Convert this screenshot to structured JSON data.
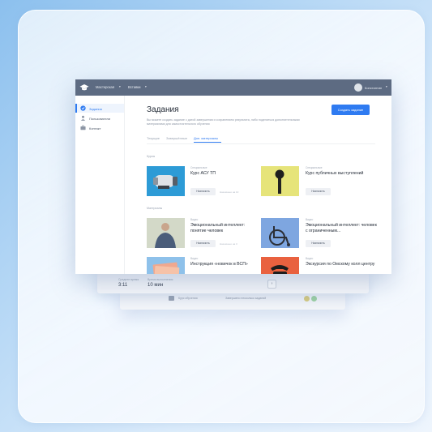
{
  "topbar": {
    "nav": [
      "Мастерская",
      "Вставки"
    ],
    "user": "Константин"
  },
  "sidebar": {
    "items": [
      {
        "label": "Задания",
        "active": true
      },
      {
        "label": "Пользователи",
        "active": false
      },
      {
        "label": "Контакт",
        "active": false
      }
    ]
  },
  "page": {
    "title": "Задания",
    "description": "Вы можете создать задание с датой завершения и сохранением результата, либо поделиться дополнительными материалами для самостоятельного обучения",
    "create_button": "Создать задание"
  },
  "tabs": [
    {
      "label": "Текущие",
      "active": false
    },
    {
      "label": "Завершённые",
      "active": false
    },
    {
      "label": "Доп. материалы",
      "active": true
    }
  ],
  "sections": {
    "courses": "Курсы",
    "materials": "Материалы"
  },
  "cards": [
    {
      "category": "Специальные",
      "title": "Курс АСУ ТП",
      "button": "Назначить",
      "meta": "Назначено на 10"
    },
    {
      "category": "Специальные",
      "title": "Курс публичных выступлений",
      "button": "Назначить",
      "meta": ""
    },
    {
      "category": "Видео",
      "title": "Эмоциональный интеллект: понятие человек",
      "button": "Назначить",
      "meta": "Назначено на 3"
    },
    {
      "category": "Видео",
      "title": "Эмоциональный интеллект: человек с ограниченным...",
      "button": "Назначить",
      "meta": ""
    },
    {
      "category": "Видео",
      "title": "Инструкция «новичок в ВСП»",
      "button": "",
      "meta": ""
    },
    {
      "category": "Видео",
      "title": "Экскурсия по Омскому колл центру",
      "button": "",
      "meta": ""
    }
  ],
  "back_panel": {
    "label_left": "Среднее время",
    "value_left": "3:11",
    "label_right": "Время выполнения",
    "value_right": "10 мин"
  },
  "back_panel2": {
    "item": "Курс обучения",
    "status": "Завершено несколько заданий"
  },
  "colors": {
    "accent": "#2f7bf1",
    "topbar": "#5d6b82"
  }
}
